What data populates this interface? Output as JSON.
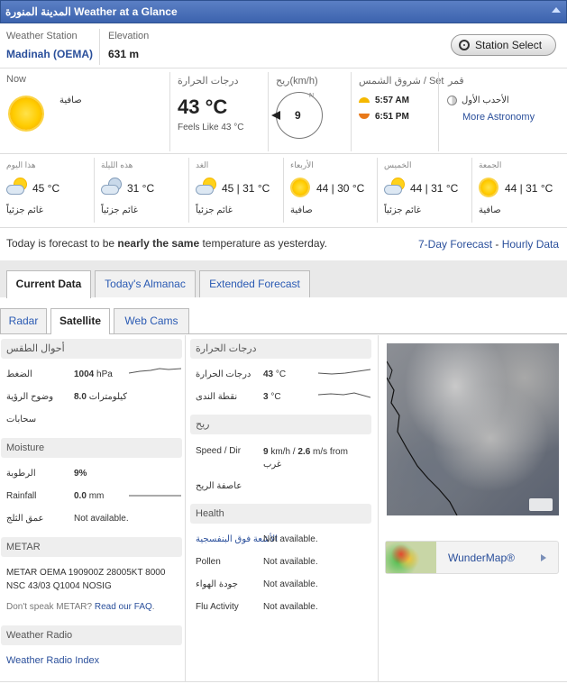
{
  "header": {
    "title": "Weather at a Glance",
    "title_ar": "المدينة المنورة"
  },
  "station": {
    "station_label": "Weather Station",
    "station_name": "Madinah (OEMA)",
    "elevation_label": "Elevation",
    "elevation_value": "631 m",
    "select_button": "Station Select"
  },
  "now": {
    "label": "Now",
    "condition": "صافية",
    "temp_label": "درجات الحرارة",
    "temp": "43 °C",
    "feels_like": "Feels Like 43 °C",
    "wind_label": "ريح(km/h)",
    "wind_dir": "N",
    "wind_speed": "9",
    "sun_label": "شروق الشمس / Set",
    "sunrise": "5:57 AM",
    "sunset": "6:51 PM",
    "moon_label": "قمر",
    "moon_phase": "الأحدب الأول",
    "more_astronomy": "More Astronomy"
  },
  "forecast": [
    {
      "day": "هذا اليوم",
      "temp": "45 °C",
      "cond": "غائم جزئياً",
      "icon": "partly-cloudy-icon"
    },
    {
      "day": "هذه الليلة",
      "temp": "31 °C",
      "cond": "غائم جزئياً",
      "icon": "partly-cloudy-night-icon"
    },
    {
      "day": "الغد",
      "temp": "45 | 31 °C",
      "cond": "غائم جزئياً",
      "icon": "partly-cloudy-icon"
    },
    {
      "day": "الأربعاء",
      "temp": "44 | 30 °C",
      "cond": "صافية",
      "icon": "sunny-icon"
    },
    {
      "day": "الخميس",
      "temp": "44 | 31 °C",
      "cond": "غائم جزئياً",
      "icon": "partly-cloudy-icon"
    },
    {
      "day": "الجمعة",
      "temp": "44 | 31 °C",
      "cond": "صافية",
      "icon": "sunny-icon"
    }
  ],
  "summary": {
    "pre": "Today is forecast to be ",
    "bold": "nearly the same",
    "post": " temperature as yesterday.",
    "link1": "7-Day Forecast",
    "sep": " - ",
    "link2": "Hourly Data"
  },
  "tabs": [
    {
      "label": "Current Data"
    },
    {
      "label": "Today's Almanac"
    },
    {
      "label": "Extended Forecast"
    }
  ],
  "subtabs": [
    {
      "label": "Radar"
    },
    {
      "label": "Satellite"
    },
    {
      "label": "Web Cams"
    }
  ],
  "conditions": {
    "header": "أحوال الطقس",
    "pressure_label": "الضغط",
    "pressure_value": "1004",
    "pressure_unit": "hPa",
    "visibility_label": "وضوح الرؤية",
    "visibility_value": "8.0",
    "visibility_unit": "كيلومترات",
    "clouds_label": "سحابات"
  },
  "moisture": {
    "header": "Moisture",
    "humidity_label": "الرطوبة",
    "humidity_value": "9%",
    "rainfall_label": "Rainfall",
    "rainfall_value": "0.0",
    "rainfall_unit": "mm",
    "snow_label": "عمق الثلج",
    "snow_value": "Not available."
  },
  "metar": {
    "header": "METAR",
    "text": "METAR OEMA 190900Z 28005KT 8000 NSC 43/03 Q1004 NOSIG",
    "help_pre": "Don't speak METAR? ",
    "help_link": "Read our FAQ",
    "help_post": "."
  },
  "radio": {
    "header": "Weather Radio",
    "link": "Weather Radio Index"
  },
  "temperature": {
    "header": "درجات الحرارة",
    "temp_label": "درجات الحرارة",
    "temp_value": "43",
    "temp_unit": "°C",
    "dew_label": "نقطة الندى",
    "dew_value": "3",
    "dew_unit": "°C"
  },
  "wind": {
    "header": "ريح",
    "speed_label": "Speed / Dir",
    "speed_kmh": "9",
    "speed_unit1": "km/h / ",
    "speed_ms": "2.6",
    "speed_unit2": "m/s from",
    "direction": "غرب",
    "gust_label": "عاصفة الريح"
  },
  "health": {
    "header": "Health",
    "uv_label": "الأشعة فوق البنفسجية",
    "uv_value": "Not available.",
    "pollen_label": "Pollen",
    "pollen_value": "Not available.",
    "air_label": "جودة الهواء",
    "air_value": "Not available.",
    "flu_label": "Flu Activity",
    "flu_value": "Not available."
  },
  "wundermap": {
    "label": "WunderMap®"
  },
  "colors": {
    "header_bg": "#4a6fb8",
    "link": "#2a4f9b",
    "sunrise": "#f5b800",
    "sunset": "#e8791a"
  }
}
